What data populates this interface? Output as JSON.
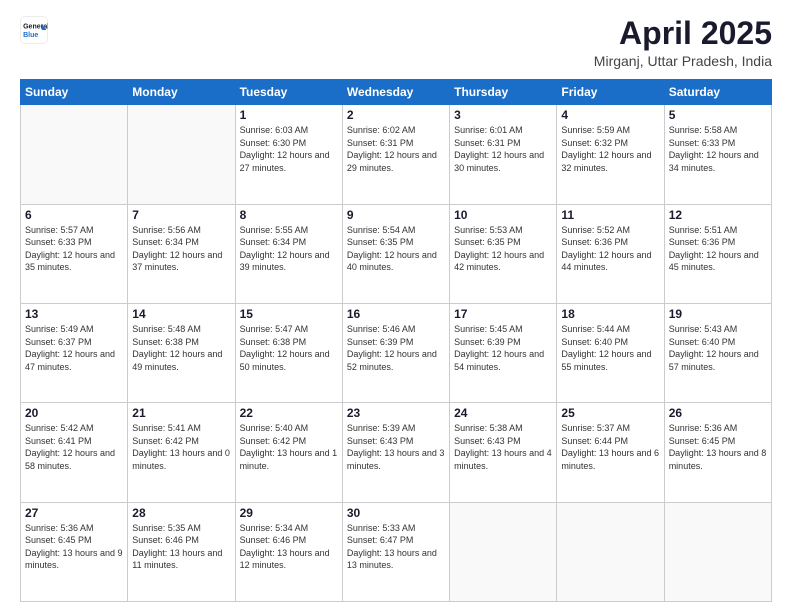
{
  "header": {
    "logo_line1": "General",
    "logo_line2": "Blue",
    "month": "April 2025",
    "location": "Mirganj, Uttar Pradesh, India"
  },
  "weekdays": [
    "Sunday",
    "Monday",
    "Tuesday",
    "Wednesday",
    "Thursday",
    "Friday",
    "Saturday"
  ],
  "weeks": [
    [
      {
        "day": "",
        "info": ""
      },
      {
        "day": "",
        "info": ""
      },
      {
        "day": "1",
        "info": "Sunrise: 6:03 AM\nSunset: 6:30 PM\nDaylight: 12 hours and 27 minutes."
      },
      {
        "day": "2",
        "info": "Sunrise: 6:02 AM\nSunset: 6:31 PM\nDaylight: 12 hours and 29 minutes."
      },
      {
        "day": "3",
        "info": "Sunrise: 6:01 AM\nSunset: 6:31 PM\nDaylight: 12 hours and 30 minutes."
      },
      {
        "day": "4",
        "info": "Sunrise: 5:59 AM\nSunset: 6:32 PM\nDaylight: 12 hours and 32 minutes."
      },
      {
        "day": "5",
        "info": "Sunrise: 5:58 AM\nSunset: 6:33 PM\nDaylight: 12 hours and 34 minutes."
      }
    ],
    [
      {
        "day": "6",
        "info": "Sunrise: 5:57 AM\nSunset: 6:33 PM\nDaylight: 12 hours and 35 minutes."
      },
      {
        "day": "7",
        "info": "Sunrise: 5:56 AM\nSunset: 6:34 PM\nDaylight: 12 hours and 37 minutes."
      },
      {
        "day": "8",
        "info": "Sunrise: 5:55 AM\nSunset: 6:34 PM\nDaylight: 12 hours and 39 minutes."
      },
      {
        "day": "9",
        "info": "Sunrise: 5:54 AM\nSunset: 6:35 PM\nDaylight: 12 hours and 40 minutes."
      },
      {
        "day": "10",
        "info": "Sunrise: 5:53 AM\nSunset: 6:35 PM\nDaylight: 12 hours and 42 minutes."
      },
      {
        "day": "11",
        "info": "Sunrise: 5:52 AM\nSunset: 6:36 PM\nDaylight: 12 hours and 44 minutes."
      },
      {
        "day": "12",
        "info": "Sunrise: 5:51 AM\nSunset: 6:36 PM\nDaylight: 12 hours and 45 minutes."
      }
    ],
    [
      {
        "day": "13",
        "info": "Sunrise: 5:49 AM\nSunset: 6:37 PM\nDaylight: 12 hours and 47 minutes."
      },
      {
        "day": "14",
        "info": "Sunrise: 5:48 AM\nSunset: 6:38 PM\nDaylight: 12 hours and 49 minutes."
      },
      {
        "day": "15",
        "info": "Sunrise: 5:47 AM\nSunset: 6:38 PM\nDaylight: 12 hours and 50 minutes."
      },
      {
        "day": "16",
        "info": "Sunrise: 5:46 AM\nSunset: 6:39 PM\nDaylight: 12 hours and 52 minutes."
      },
      {
        "day": "17",
        "info": "Sunrise: 5:45 AM\nSunset: 6:39 PM\nDaylight: 12 hours and 54 minutes."
      },
      {
        "day": "18",
        "info": "Sunrise: 5:44 AM\nSunset: 6:40 PM\nDaylight: 12 hours and 55 minutes."
      },
      {
        "day": "19",
        "info": "Sunrise: 5:43 AM\nSunset: 6:40 PM\nDaylight: 12 hours and 57 minutes."
      }
    ],
    [
      {
        "day": "20",
        "info": "Sunrise: 5:42 AM\nSunset: 6:41 PM\nDaylight: 12 hours and 58 minutes."
      },
      {
        "day": "21",
        "info": "Sunrise: 5:41 AM\nSunset: 6:42 PM\nDaylight: 13 hours and 0 minutes."
      },
      {
        "day": "22",
        "info": "Sunrise: 5:40 AM\nSunset: 6:42 PM\nDaylight: 13 hours and 1 minute."
      },
      {
        "day": "23",
        "info": "Sunrise: 5:39 AM\nSunset: 6:43 PM\nDaylight: 13 hours and 3 minutes."
      },
      {
        "day": "24",
        "info": "Sunrise: 5:38 AM\nSunset: 6:43 PM\nDaylight: 13 hours and 4 minutes."
      },
      {
        "day": "25",
        "info": "Sunrise: 5:37 AM\nSunset: 6:44 PM\nDaylight: 13 hours and 6 minutes."
      },
      {
        "day": "26",
        "info": "Sunrise: 5:36 AM\nSunset: 6:45 PM\nDaylight: 13 hours and 8 minutes."
      }
    ],
    [
      {
        "day": "27",
        "info": "Sunrise: 5:36 AM\nSunset: 6:45 PM\nDaylight: 13 hours and 9 minutes."
      },
      {
        "day": "28",
        "info": "Sunrise: 5:35 AM\nSunset: 6:46 PM\nDaylight: 13 hours and 11 minutes."
      },
      {
        "day": "29",
        "info": "Sunrise: 5:34 AM\nSunset: 6:46 PM\nDaylight: 13 hours and 12 minutes."
      },
      {
        "day": "30",
        "info": "Sunrise: 5:33 AM\nSunset: 6:47 PM\nDaylight: 13 hours and 13 minutes."
      },
      {
        "day": "",
        "info": ""
      },
      {
        "day": "",
        "info": ""
      },
      {
        "day": "",
        "info": ""
      }
    ]
  ]
}
